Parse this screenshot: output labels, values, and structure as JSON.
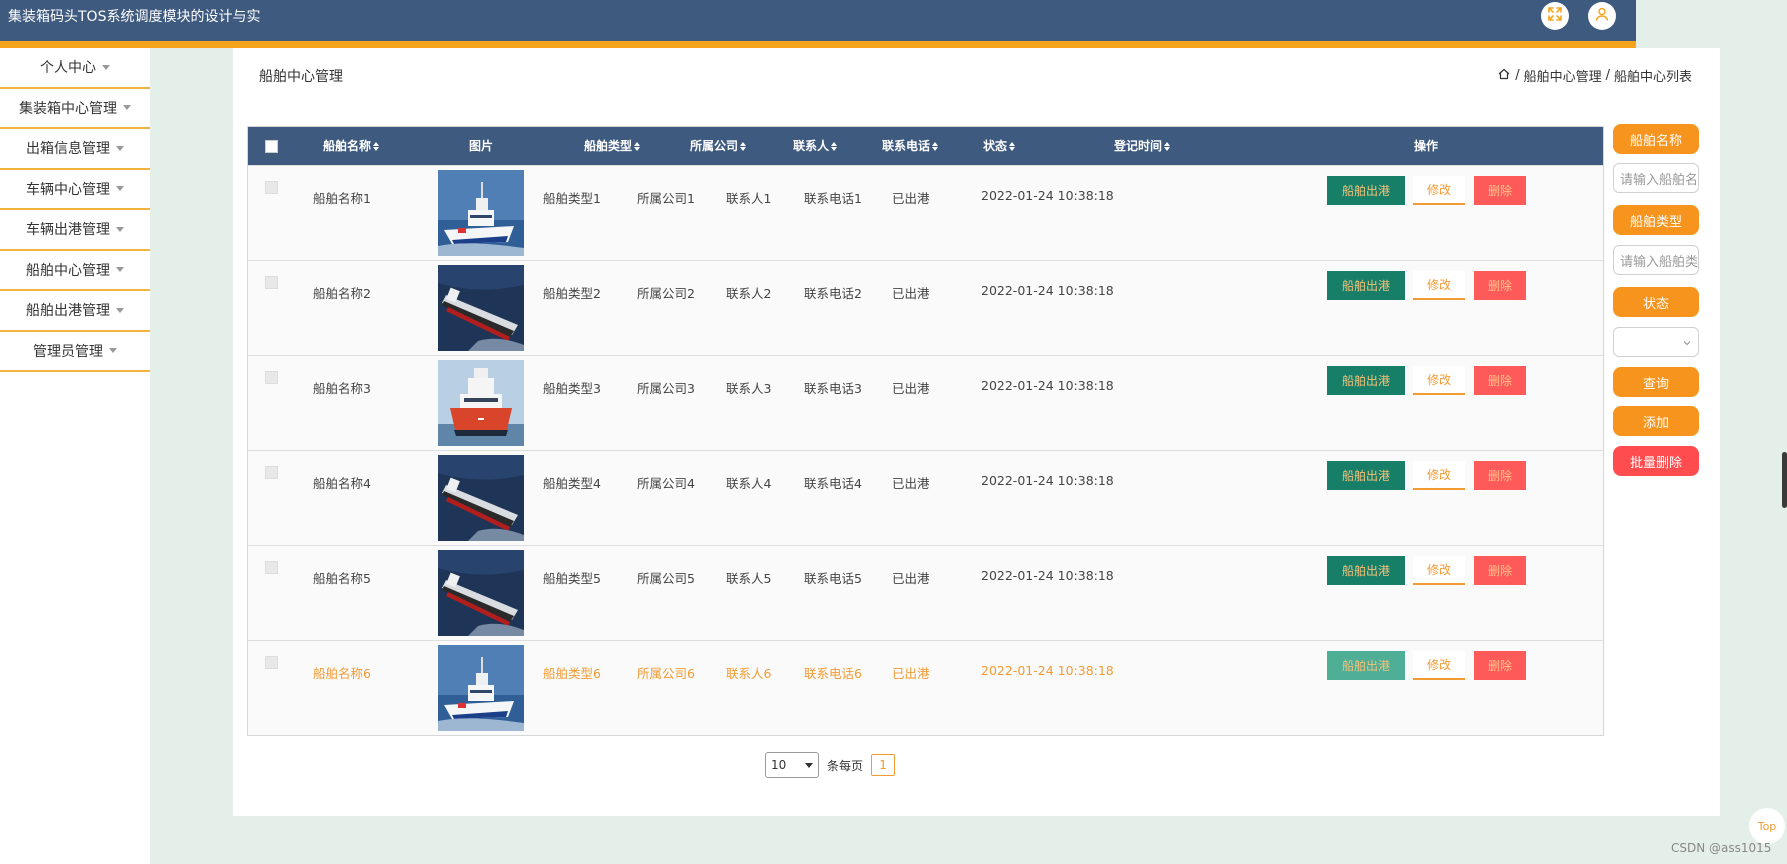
{
  "header": {
    "title": "集装箱码头TOS系统调度模块的设计与实",
    "fullscreen_icon": "expand-icon",
    "user_icon": "user-icon"
  },
  "sidebar": {
    "items": [
      {
        "label": "个人中心"
      },
      {
        "label": "集装箱中心管理"
      },
      {
        "label": "出箱信息管理"
      },
      {
        "label": "车辆中心管理"
      },
      {
        "label": "车辆出港管理"
      },
      {
        "label": "船舶中心管理"
      },
      {
        "label": "船舶出港管理"
      },
      {
        "label": "管理员管理"
      }
    ]
  },
  "page": {
    "title": "船舶中心管理",
    "breadcrumb": {
      "sep": "/",
      "items": [
        "船舶中心管理",
        "船舶中心列表"
      ]
    }
  },
  "table": {
    "columns": {
      "name": "船舶名称",
      "image": "图片",
      "type": "船舶类型",
      "company": "所属公司",
      "contact": "联系人",
      "phone": "联系电话",
      "status": "状态",
      "time": "登记时间",
      "actions": "操作"
    },
    "action_labels": {
      "depart": "船舶出港",
      "edit": "修改",
      "delete": "删除"
    },
    "rows": [
      {
        "name": "船舶名称1",
        "image": "patrol-ship",
        "type": "船舶类型1",
        "company": "所属公司1",
        "contact": "联系人1",
        "phone": "联系电话1",
        "status": "已出港",
        "time": "2022-01-24 10:38:18"
      },
      {
        "name": "船舶名称2",
        "image": "tanker-ship",
        "type": "船舶类型2",
        "company": "所属公司2",
        "contact": "联系人2",
        "phone": "联系电话2",
        "status": "已出港",
        "time": "2022-01-24 10:38:18"
      },
      {
        "name": "船舶名称3",
        "image": "red-hull-ship",
        "type": "船舶类型3",
        "company": "所属公司3",
        "contact": "联系人3",
        "phone": "联系电话3",
        "status": "已出港",
        "time": "2022-01-24 10:38:18"
      },
      {
        "name": "船舶名称4",
        "image": "tanker-ship",
        "type": "船舶类型4",
        "company": "所属公司4",
        "contact": "联系人4",
        "phone": "联系电话4",
        "status": "已出港",
        "time": "2022-01-24 10:38:18"
      },
      {
        "name": "船舶名称5",
        "image": "tanker-ship",
        "type": "船舶类型5",
        "company": "所属公司5",
        "contact": "联系人5",
        "phone": "联系电话5",
        "status": "已出港",
        "time": "2022-01-24 10:38:18"
      },
      {
        "name": "船舶名称6",
        "image": "patrol-ship",
        "type": "船舶类型6",
        "company": "所属公司6",
        "contact": "联系人6",
        "phone": "联系电话6",
        "status": "已出港",
        "time": "2022-01-24 10:38:18"
      }
    ]
  },
  "pagination": {
    "page_size": "10",
    "per_page_label": "条每页",
    "current_page": "1"
  },
  "filters": {
    "name_label": "船舶名称",
    "name_placeholder": "请输入船舶名称",
    "type_label": "船舶类型",
    "type_placeholder": "请输入船舶类型",
    "status_label": "状态",
    "status_value": "",
    "search_label": "查询",
    "add_label": "添加",
    "batch_delete_label": "批量删除"
  },
  "back_to_top": "Top",
  "watermark": "CSDN @ass1015",
  "colors": {
    "header": "#3f5a7f",
    "accent": "#f7941d",
    "danger": "#ff4d4f",
    "depart": "#177e68"
  }
}
